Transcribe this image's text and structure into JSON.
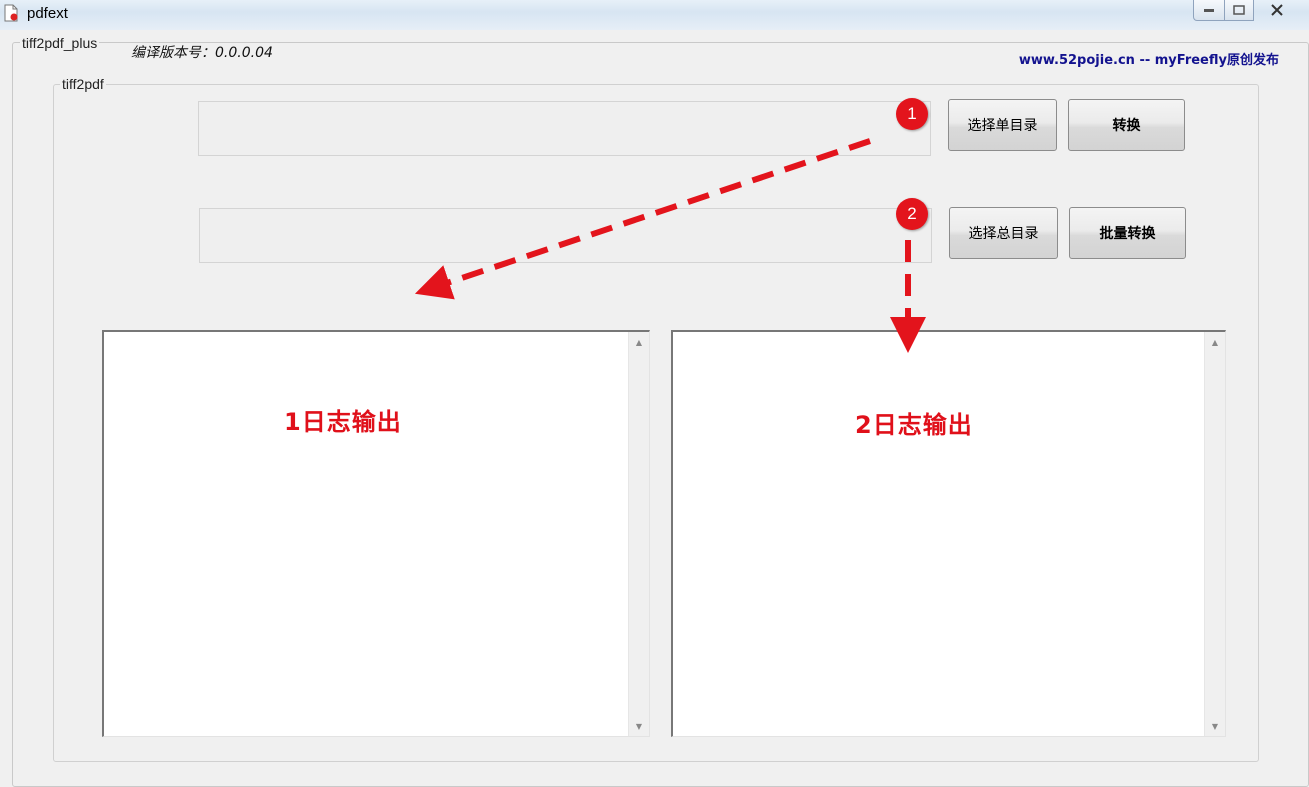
{
  "window": {
    "title": "pdfext"
  },
  "outer_group": {
    "legend": "tiff2pdf_plus",
    "version": "编译版本号：0.0.0.04",
    "site": "www.52pojie.cn -- myFreefly原创发布"
  },
  "inner_group": {
    "legend": "tiff2pdf"
  },
  "single": {
    "path_value": "",
    "select_label": "选择单目录",
    "convert_label": "转换"
  },
  "batch": {
    "path_value": "",
    "select_label": "选择总目录",
    "convert_label": "批量转换"
  },
  "logs": {
    "log1_label": "1日志输出",
    "log2_label": "2日志输出"
  },
  "annotations": {
    "badge1": "1",
    "badge2": "2"
  },
  "colors": {
    "annotation_red": "#e3141c",
    "site_blue": "#13138f"
  }
}
